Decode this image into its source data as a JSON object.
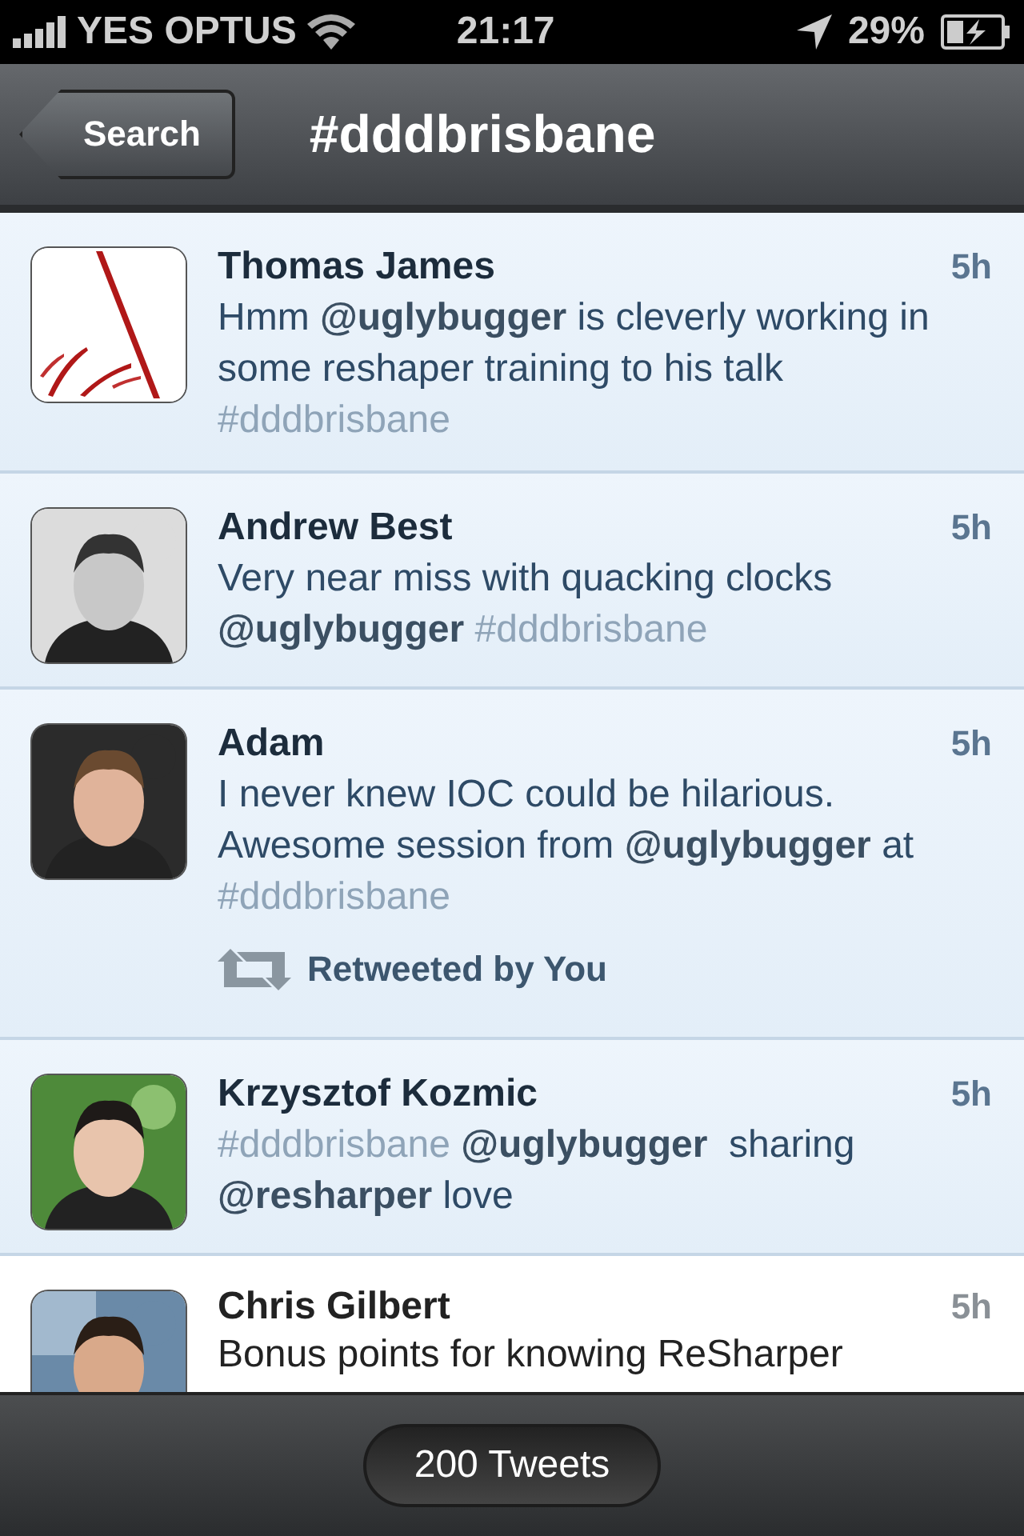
{
  "status_bar": {
    "carrier": "YES OPTUS",
    "time": "21:17",
    "battery": "29%"
  },
  "nav_bar": {
    "back": "Search",
    "title": "#dddbrisbane"
  },
  "tweets": [
    {
      "name": "Thomas James",
      "time": "5h",
      "unread": true,
      "body": "Hmm @uglybugger is cleverly working in some reshaper training to his talk #dddbrisbane"
    },
    {
      "name": "Andrew Best",
      "time": "5h",
      "unread": true,
      "body": "Very near miss with quacking clocks @uglybugger #dddbrisbane"
    },
    {
      "name": "Adam",
      "time": "5h",
      "unread": true,
      "body": "I never knew IOC could be hilarious. Awesome session from @uglybugger at #dddbrisbane",
      "retweet": "Retweeted by You"
    },
    {
      "name": "Krzysztof Kozmic",
      "time": "5h",
      "unread": true,
      "body": "#dddbrisbane @uglybugger  sharing @resharper love"
    },
    {
      "name": "Chris Gilbert",
      "time": "5h",
      "unread": false,
      "body": "Bonus points for knowing ReSharper"
    }
  ],
  "footer": {
    "count": "200 Tweets"
  }
}
